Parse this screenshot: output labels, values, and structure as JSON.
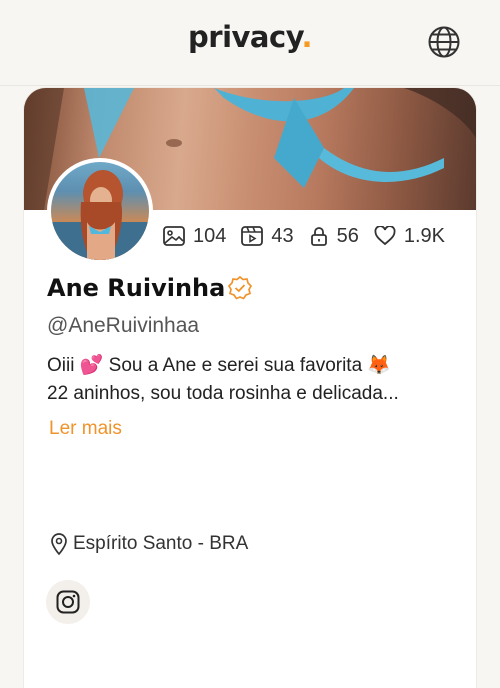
{
  "header": {
    "logo_text": "privacy",
    "logo_dot": ".",
    "language_icon": "globe-icon"
  },
  "profile": {
    "name": "Ane Ruivinha",
    "handle": "@AneRuivinhaa",
    "verified_icon": "verified-badge-icon",
    "stats": {
      "photos": "104",
      "videos": "43",
      "locked": "56",
      "likes": "1.9K"
    },
    "bio_line1": "Oiii 💕 Sou a Ane e serei sua favorita 🦊",
    "bio_line2": "22 aninhos, sou toda rosinha e delicada...",
    "read_more": "Ler mais",
    "location": "Espírito Santo - BRA",
    "social_icon": "instagram-icon"
  },
  "colors": {
    "accent": "#f0932b",
    "background": "#f8f6f3",
    "card": "#ffffff"
  }
}
